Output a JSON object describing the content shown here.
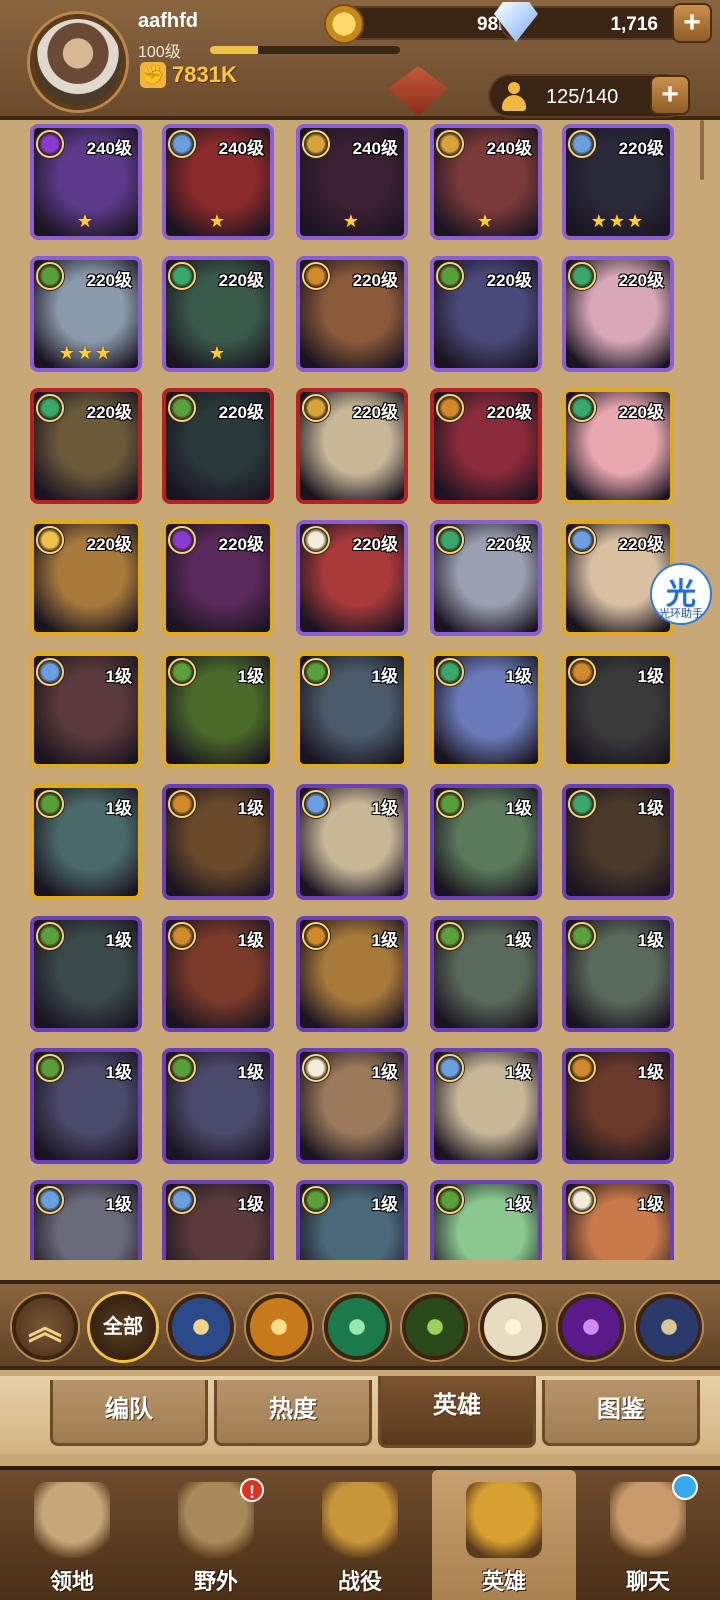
{
  "player": {
    "name": "aafhfd",
    "level": "100级",
    "xp_fraction": 0.25,
    "power": "7831K"
  },
  "resources": {
    "gold": "98M",
    "gems": "1,716",
    "plus": "+"
  },
  "roster": {
    "capacity": "125/140"
  },
  "assistant": {
    "glyph": "光",
    "label": "光环助手"
  },
  "colors": {
    "frame_purple": "#8a5fd6",
    "frame_red": "#b52222",
    "frame_gold": "#e0aa1e",
    "frame_violet": "#6b3fb8",
    "star": "#ffcf2e"
  },
  "factions": {
    "lightbearer": "#f1c24a",
    "mauler": "#d08a2a",
    "wilder": "#3aa86a",
    "graveborn": "#5aa03a",
    "celestial": "#f3ecd8",
    "hypogean": "#8a3ad0",
    "dimensional": "#6aa0e0",
    "star": "#d8a43a"
  },
  "heroes": [
    {
      "level": "240级",
      "stars": "★",
      "frame": "purple",
      "faction": "hypogean",
      "bg": "#5b3a8a"
    },
    {
      "level": "240级",
      "stars": "★",
      "frame": "purple",
      "faction": "dimensional",
      "bg": "#8a2a2a"
    },
    {
      "level": "240级",
      "stars": "★",
      "frame": "purple",
      "faction": "star",
      "bg": "#3a2030"
    },
    {
      "level": "240级",
      "stars": "★",
      "frame": "purple",
      "faction": "star",
      "bg": "#7a3a3a"
    },
    {
      "level": "220级",
      "stars": "★★★",
      "frame": "purple",
      "faction": "dimensional",
      "bg": "#2a2a3a"
    },
    {
      "level": "220级",
      "stars": "★★★",
      "frame": "purple",
      "faction": "graveborn",
      "bg": "#8a9aaa"
    },
    {
      "level": "220级",
      "stars": "★",
      "frame": "purple",
      "faction": "wilder",
      "bg": "#3a5a4a"
    },
    {
      "level": "220级",
      "stars": "",
      "frame": "purple",
      "faction": "mauler",
      "bg": "#8a5a3a"
    },
    {
      "level": "220级",
      "stars": "",
      "frame": "purple",
      "faction": "graveborn",
      "bg": "#4a4a7a"
    },
    {
      "level": "220级",
      "stars": "",
      "frame": "purple",
      "faction": "wilder",
      "bg": "#d8a8b8"
    },
    {
      "level": "220级",
      "stars": "",
      "frame": "red",
      "faction": "wilder",
      "bg": "#6a5a3a"
    },
    {
      "level": "220级",
      "stars": "",
      "frame": "red",
      "faction": "graveborn",
      "bg": "#2a3a3a"
    },
    {
      "level": "220级",
      "stars": "",
      "frame": "red",
      "faction": "star",
      "bg": "#c8b898"
    },
    {
      "level": "220级",
      "stars": "",
      "frame": "red",
      "faction": "mauler",
      "bg": "#8a2a3a"
    },
    {
      "level": "220级",
      "stars": "",
      "frame": "gold",
      "faction": "wilder",
      "bg": "#e8a8b0"
    },
    {
      "level": "220级",
      "stars": "",
      "frame": "gold",
      "faction": "lightbearer",
      "bg": "#a87a3a"
    },
    {
      "level": "220级",
      "stars": "",
      "frame": "gold",
      "faction": "hypogean",
      "bg": "#5a2a5a"
    },
    {
      "level": "220级",
      "stars": "",
      "frame": "purple",
      "faction": "celestial",
      "bg": "#a83a3a"
    },
    {
      "level": "220级",
      "stars": "",
      "frame": "purple",
      "faction": "wilder",
      "bg": "#9aa0b0"
    },
    {
      "level": "220级",
      "stars": "",
      "frame": "gold",
      "faction": "dimensional",
      "bg": "#d8c0a0"
    },
    {
      "level": "1级",
      "stars": "",
      "frame": "gold",
      "faction": "dimensional",
      "bg": "#5a3a3a"
    },
    {
      "level": "1级",
      "stars": "",
      "frame": "gold",
      "faction": "graveborn",
      "bg": "#4a6a2a"
    },
    {
      "level": "1级",
      "stars": "",
      "frame": "gold",
      "faction": "graveborn",
      "bg": "#4a5a6a"
    },
    {
      "level": "1级",
      "stars": "",
      "frame": "gold",
      "faction": "wilder",
      "bg": "#6a7ab8"
    },
    {
      "level": "1级",
      "stars": "",
      "frame": "gold",
      "faction": "mauler",
      "bg": "#3a3a3a"
    },
    {
      "level": "1级",
      "stars": "",
      "frame": "gold",
      "faction": "graveborn",
      "bg": "#4a6a6a"
    },
    {
      "level": "1级",
      "stars": "",
      "frame": "violet",
      "faction": "mauler",
      "bg": "#6a4a2a"
    },
    {
      "level": "1级",
      "stars": "",
      "frame": "violet",
      "faction": "dimensional",
      "bg": "#c8b898"
    },
    {
      "level": "1级",
      "stars": "",
      "frame": "violet",
      "faction": "graveborn",
      "bg": "#5a7a5a"
    },
    {
      "level": "1级",
      "stars": "",
      "frame": "violet",
      "faction": "wilder",
      "bg": "#4a3a2a"
    },
    {
      "level": "1级",
      "stars": "",
      "frame": "violet",
      "faction": "graveborn",
      "bg": "#3a4a4a"
    },
    {
      "level": "1级",
      "stars": "",
      "frame": "violet",
      "faction": "mauler",
      "bg": "#7a3a2a"
    },
    {
      "level": "1级",
      "stars": "",
      "frame": "violet",
      "faction": "mauler",
      "bg": "#a87a3a"
    },
    {
      "level": "1级",
      "stars": "",
      "frame": "violet",
      "faction": "graveborn",
      "bg": "#5a6a5a"
    },
    {
      "level": "1级",
      "stars": "",
      "frame": "violet",
      "faction": "graveborn",
      "bg": "#5a6a5a"
    },
    {
      "level": "1级",
      "stars": "",
      "frame": "violet",
      "faction": "graveborn",
      "bg": "#4a4a6a"
    },
    {
      "level": "1级",
      "stars": "",
      "frame": "violet",
      "faction": "graveborn",
      "bg": "#4a4a6a"
    },
    {
      "level": "1级",
      "stars": "",
      "frame": "violet",
      "faction": "celestial",
      "bg": "#9a7a5a"
    },
    {
      "level": "1级",
      "stars": "",
      "frame": "violet",
      "faction": "dimensional",
      "bg": "#c8b898"
    },
    {
      "level": "1级",
      "stars": "",
      "frame": "violet",
      "faction": "mauler",
      "bg": "#6a3a2a"
    },
    {
      "level": "1级",
      "stars": "",
      "frame": "violet",
      "faction": "dimensional",
      "bg": "#6a6a7a"
    },
    {
      "level": "1级",
      "stars": "",
      "frame": "violet",
      "faction": "dimensional",
      "bg": "#5a3a3a"
    },
    {
      "level": "1级",
      "stars": "",
      "frame": "violet",
      "faction": "graveborn",
      "bg": "#4a6a7a"
    },
    {
      "level": "1级",
      "stars": "",
      "frame": "violet",
      "faction": "graveborn",
      "bg": "#8ac890"
    },
    {
      "level": "1级",
      "stars": "",
      "frame": "violet",
      "faction": "celestial",
      "bg": "#c87a4a"
    }
  ],
  "filters": {
    "collapse_icon": "chevron-up-icon",
    "all_label": "全部",
    "factions": [
      {
        "name": "dimensional-filter",
        "color": "#2a4a8a",
        "ring": "#f1d48a"
      },
      {
        "name": "lightbearer-filter",
        "color": "#c87a1a",
        "ring": "#ffe08a"
      },
      {
        "name": "wilder-filter",
        "color": "#1a7a4a",
        "ring": "#9ae6b0"
      },
      {
        "name": "graveborn-filter",
        "color": "#2a4a1a",
        "ring": "#9ad060"
      },
      {
        "name": "celestial-filter",
        "color": "#e8dcc0",
        "ring": "#fff6d8"
      },
      {
        "name": "hypogean-filter",
        "color": "#5a1a8a",
        "ring": "#d08af0"
      },
      {
        "name": "star-filter",
        "color": "#2a3a6a",
        "ring": "#d8c898"
      }
    ]
  },
  "subtabs": [
    {
      "label": "编队"
    },
    {
      "label": "热度"
    },
    {
      "label": "英雄",
      "active": true
    },
    {
      "label": "图鉴"
    }
  ],
  "nav": [
    {
      "label": "领地",
      "icon": "castle-icon",
      "color": "#c8a87a"
    },
    {
      "label": "野外",
      "icon": "scroll-map-icon",
      "color": "#a88a5a",
      "badge": "!"
    },
    {
      "label": "战役",
      "icon": "sword-shield-icon",
      "color": "#c8963a"
    },
    {
      "label": "英雄",
      "icon": "helmet-icon",
      "color": "#d8a030",
      "active": true
    },
    {
      "label": "聊天",
      "icon": "chat-bubble-icon",
      "color": "#c89a6a",
      "dot": true
    }
  ]
}
